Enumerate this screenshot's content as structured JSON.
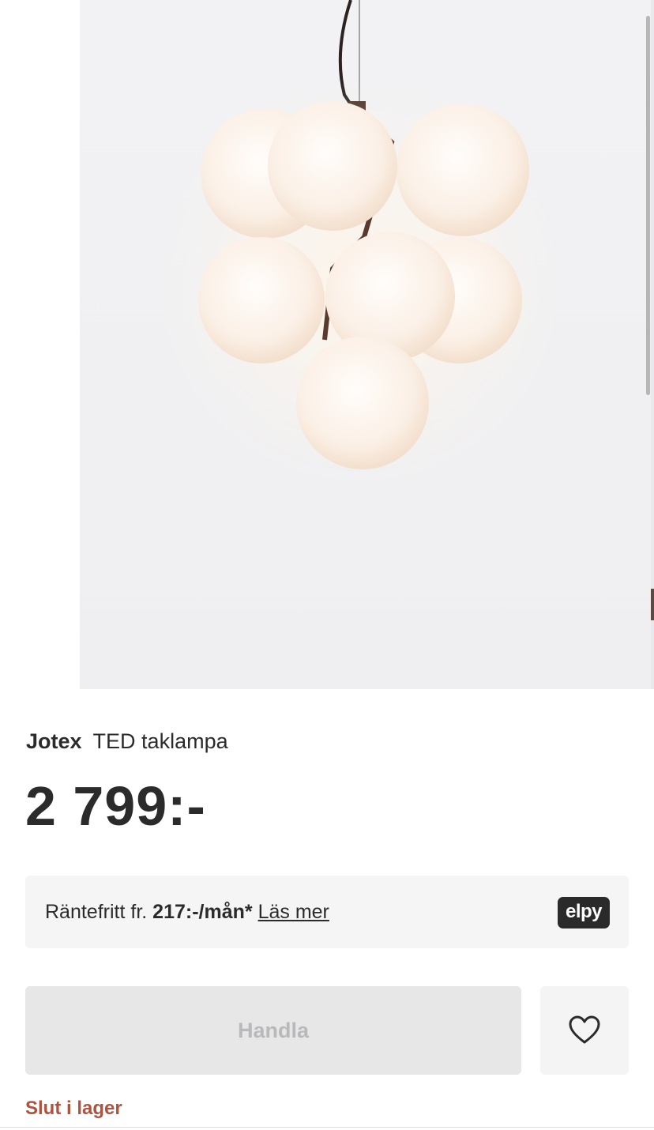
{
  "product": {
    "brand": "Jotex",
    "name": "TED taklampa",
    "price": "2 799:-",
    "image_icon": "pendant-lamp-globes"
  },
  "financing": {
    "prefix": "Räntefritt fr. ",
    "amount": "217:-/mån*",
    "link_label": "Läs mer",
    "provider_logo_text": "elpy"
  },
  "actions": {
    "buy_label": "Handla",
    "buy_enabled": false,
    "wishlist_icon": "heart-outline-icon"
  },
  "availability": {
    "status_text": "Slut i lager",
    "status_color": "#b0523d"
  }
}
